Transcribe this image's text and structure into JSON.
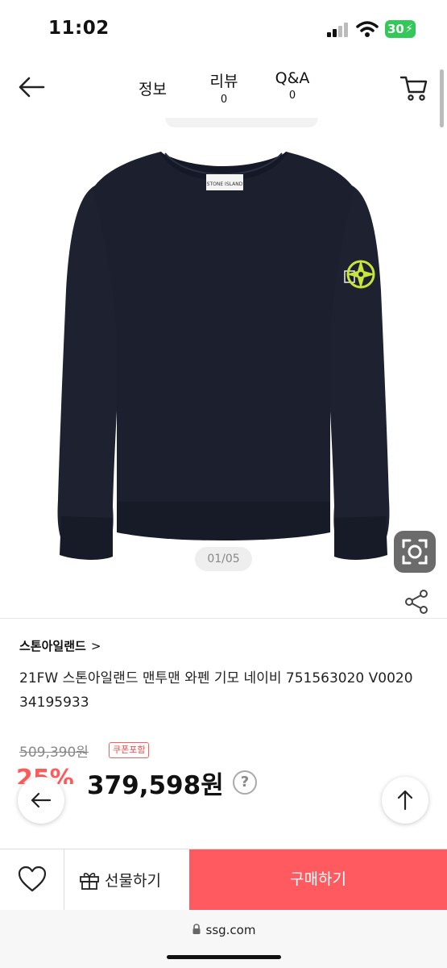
{
  "status_bar": {
    "time": "11:02",
    "battery": "30",
    "battery_color": "#34c759"
  },
  "header": {
    "tabs": [
      {
        "label": "정보",
        "count": ""
      },
      {
        "label": "리뷰",
        "count": "0"
      },
      {
        "label": "Q&A",
        "count": "0"
      }
    ],
    "icons": [
      "back-arrow-icon",
      "cart-icon"
    ]
  },
  "gallery": {
    "page_indicator": "01/05",
    "image": "navy crewneck sweatshirt with compass badge",
    "sweatshirt_color": "#1b1f2e",
    "badge_color": "#c8e63a"
  },
  "product": {
    "brand": "스톤아일랜드",
    "brand_chevron": ">",
    "title": "21FW 스톤아일랜드 맨투맨 와펜 기모 네이비 751563020 V0020 34195933",
    "original_price": "509,390원",
    "coupon_badge": "쿠폰포함",
    "discount": "25%",
    "price": "379,598원",
    "help_icon": "?"
  },
  "bottom_bar": {
    "gift_label": "선물하기",
    "buy_label": "구매하기",
    "buy_color": "#ff5a5f"
  },
  "browser": {
    "url": "ssg.com"
  }
}
